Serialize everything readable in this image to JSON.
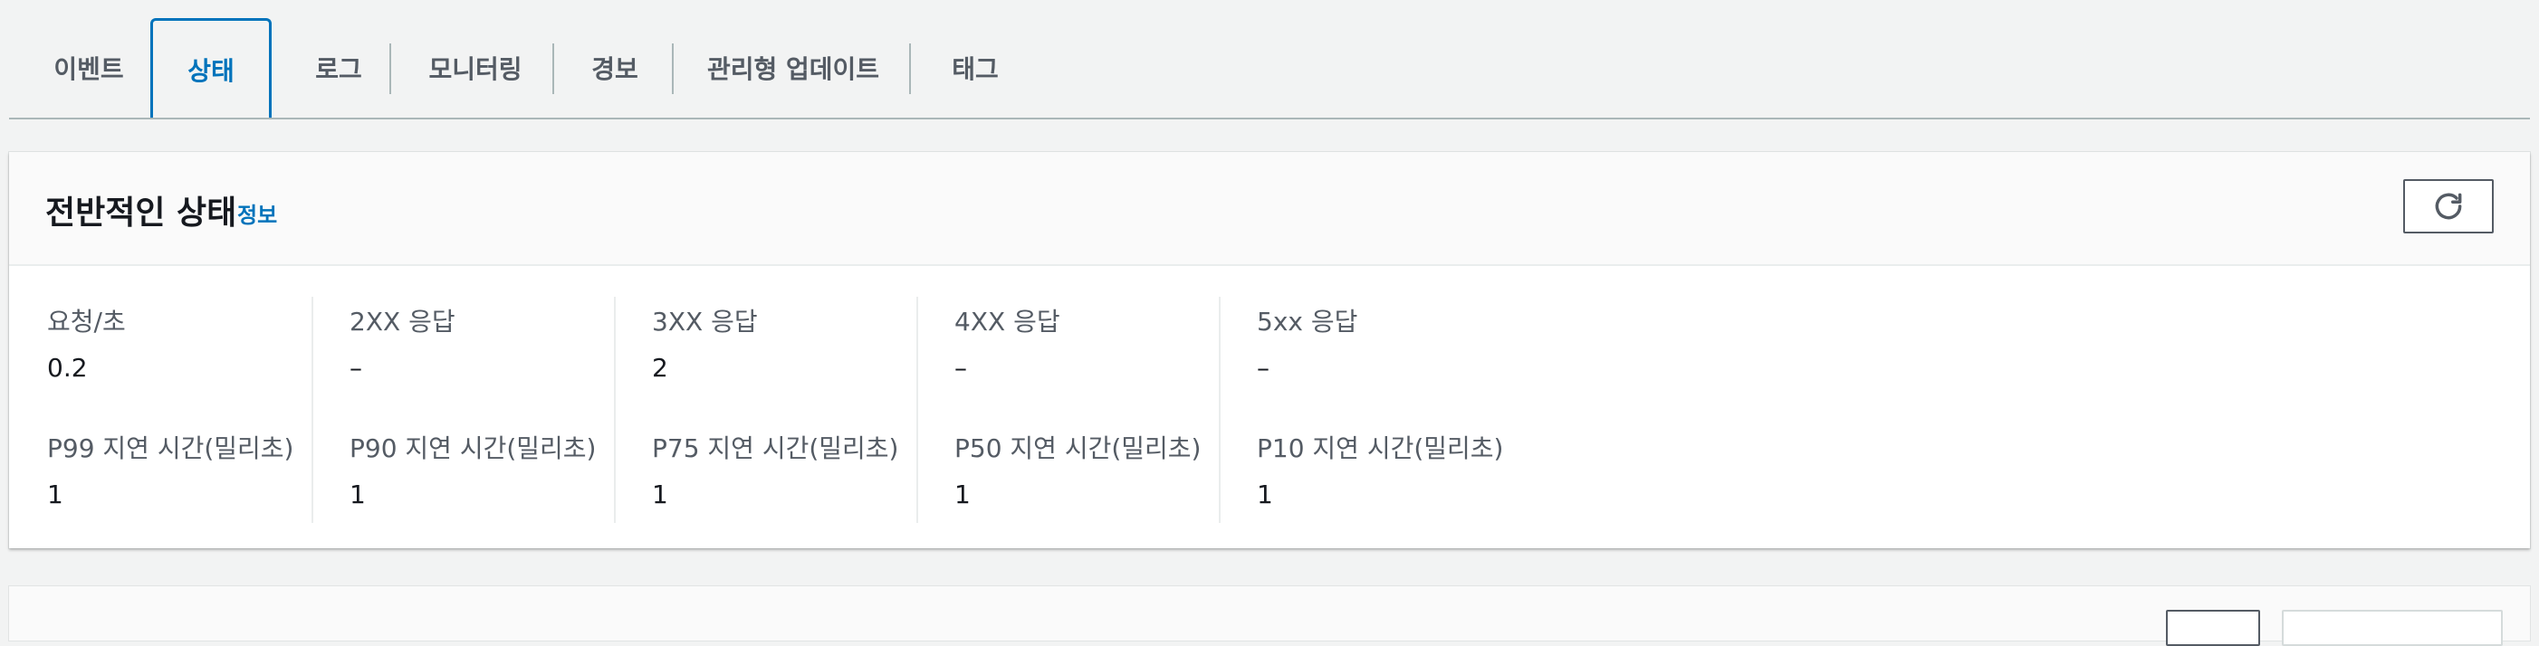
{
  "tabs": [
    {
      "label": "이벤트"
    },
    {
      "label": "상태",
      "active": true
    },
    {
      "label": "로그"
    },
    {
      "label": "모니터링"
    },
    {
      "label": "경보"
    },
    {
      "label": "관리형 업데이트"
    },
    {
      "label": "태그"
    }
  ],
  "panel": {
    "title": "전반적인 상태",
    "info": "정보",
    "refresh_icon": "refresh-icon"
  },
  "metrics": {
    "row1": [
      {
        "label": "요청/초",
        "value": "0.2"
      },
      {
        "label": "2XX 응답",
        "value": "–"
      },
      {
        "label": "3XX 응답",
        "value": "2"
      },
      {
        "label": "4XX 응답",
        "value": "–"
      },
      {
        "label": "5xx 응답",
        "value": "–"
      }
    ],
    "row2": [
      {
        "label": "P99 지연 시간(밀리초)",
        "value": "1"
      },
      {
        "label": "P90 지연 시간(밀리초)",
        "value": "1"
      },
      {
        "label": "P75 지연 시간(밀리초)",
        "value": "1"
      },
      {
        "label": "P50 지연 시간(밀리초)",
        "value": "1"
      },
      {
        "label": "P10 지연 시간(밀리초)",
        "value": "1"
      }
    ]
  },
  "colors": {
    "accent": "#0073bb",
    "text": "#16191f",
    "muted": "#545b64",
    "background": "#f2f3f3"
  }
}
